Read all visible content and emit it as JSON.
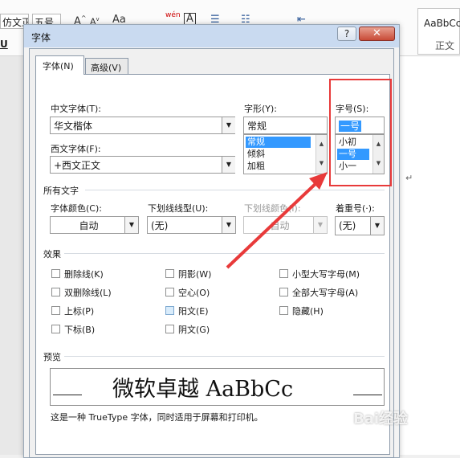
{
  "ribbon": {
    "font_name": "仿文正:",
    "font_size": "五号",
    "grow_font": "A",
    "shrink_font": "A",
    "aa": "Aa",
    "phonetic": "wén",
    "char_border": "A",
    "style_preview": "AaBbCc",
    "style_label": "正文"
  },
  "dialog": {
    "title": "字体",
    "help_label": "?",
    "close_label": "✕",
    "tabs": [
      {
        "label": "字体(N)",
        "active": true
      },
      {
        "label": "高级(V)",
        "active": false
      }
    ],
    "chinese_font": {
      "label": "中文字体(T):",
      "value": "华文楷体"
    },
    "western_font": {
      "label": "西文字体(F):",
      "value": "+西文正文"
    },
    "font_style": {
      "label": "字形(Y):",
      "value": "常规",
      "options": [
        "常规",
        "倾斜",
        "加粗"
      ],
      "selected": "常规"
    },
    "font_size": {
      "label": "字号(S):",
      "value": "一号",
      "options": [
        "小初",
        "一号",
        "小一"
      ],
      "selected": "一号"
    },
    "all_text": {
      "title": "所有文字",
      "font_color": {
        "label": "字体颜色(C):",
        "value": "自动"
      },
      "underline_type": {
        "label": "下划线线型(U):",
        "value": "(无)"
      },
      "underline_color": {
        "label": "下划线颜色(I):",
        "value": "自动"
      },
      "emphasis": {
        "label": "着重号(·):",
        "value": "(无)"
      }
    },
    "effects": {
      "title": "效果",
      "items": [
        {
          "label": "删除线(K)",
          "checked": false
        },
        {
          "label": "双删除线(L)",
          "checked": false
        },
        {
          "label": "上标(P)",
          "checked": false
        },
        {
          "label": "下标(B)",
          "checked": false
        },
        {
          "label": "阴影(W)",
          "checked": false
        },
        {
          "label": "空心(O)",
          "checked": false
        },
        {
          "label": "阳文(E)",
          "checked": false
        },
        {
          "label": "阴文(G)",
          "checked": false
        },
        {
          "label": "小型大写字母(M)",
          "checked": false
        },
        {
          "label": "全部大写字母(A)",
          "checked": false
        },
        {
          "label": "隐藏(H)",
          "checked": false
        }
      ]
    },
    "preview": {
      "title": "预览",
      "text": "微软卓越 AaBbCc",
      "note": "这是一种 TrueType 字体，同时适用于屏幕和打印机。"
    }
  },
  "overlay": {
    "watermark": "Bai经验",
    "highlight_color": "#e83a3a"
  }
}
